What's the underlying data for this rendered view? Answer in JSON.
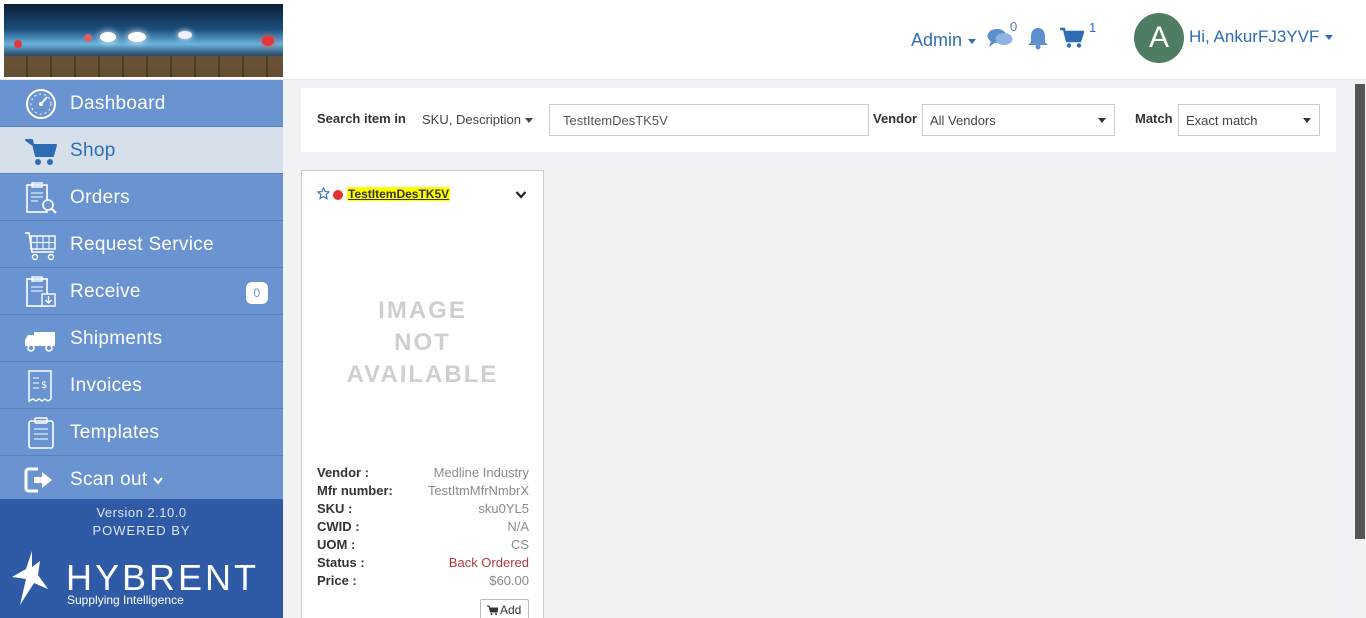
{
  "header": {
    "admin_label": "Admin",
    "messages_count": "0",
    "cart_count": "1",
    "avatar_initial": "A",
    "greeting": "Hi, AnkurFJ3YVF"
  },
  "sidebar": {
    "items": [
      {
        "label": "Dashboard",
        "icon": "dashboard-gauge-icon"
      },
      {
        "label": "Shop",
        "icon": "cart-icon"
      },
      {
        "label": "Orders",
        "icon": "orders-clipboard-search-icon"
      },
      {
        "label": "Request Service",
        "icon": "service-cart-icon"
      },
      {
        "label": "Receive",
        "icon": "receive-clipboard-icon",
        "badge": "0"
      },
      {
        "label": "Shipments",
        "icon": "truck-icon"
      },
      {
        "label": "Invoices",
        "icon": "invoice-icon"
      },
      {
        "label": "Templates",
        "icon": "templates-clipboard-icon"
      },
      {
        "label": "Scan out",
        "icon": "scan-out-icon"
      }
    ],
    "version": "Version 2.10.0",
    "powered_by": "POWERED BY",
    "brand_name": "HYBRENT",
    "brand_tagline": "Supplying Intelligence"
  },
  "search": {
    "label": "Search item in",
    "scope": "SKU, Description",
    "query": "TestItemDesTK5V",
    "vendor_label": "Vendor",
    "vendor_value": "All Vendors",
    "match_label": "Match",
    "match_value": "Exact match"
  },
  "product": {
    "name": "TestItemDesTK5V",
    "image_placeholder": [
      "IMAGE",
      "NOT",
      "AVAILABLE"
    ],
    "fields": [
      {
        "key": "Vendor :",
        "value": "Medline Industry"
      },
      {
        "key": "Mfr number:",
        "value": "TestItmMfrNmbrX"
      },
      {
        "key": "SKU :",
        "value": "sku0YL5"
      },
      {
        "key": "CWID :",
        "value": "N/A"
      },
      {
        "key": "UOM :",
        "value": "CS"
      },
      {
        "key": "Status :",
        "value": "Back Ordered"
      },
      {
        "key": "Price :",
        "value": "$60.00"
      }
    ],
    "add_label": "Add"
  },
  "colors": {
    "primary": "#2e6db4",
    "sidebar": "#6a93d2",
    "sidebar_footer": "#2f5ba6",
    "status_back_ordered": "#b33a3a",
    "highlight": "#ffff00"
  }
}
